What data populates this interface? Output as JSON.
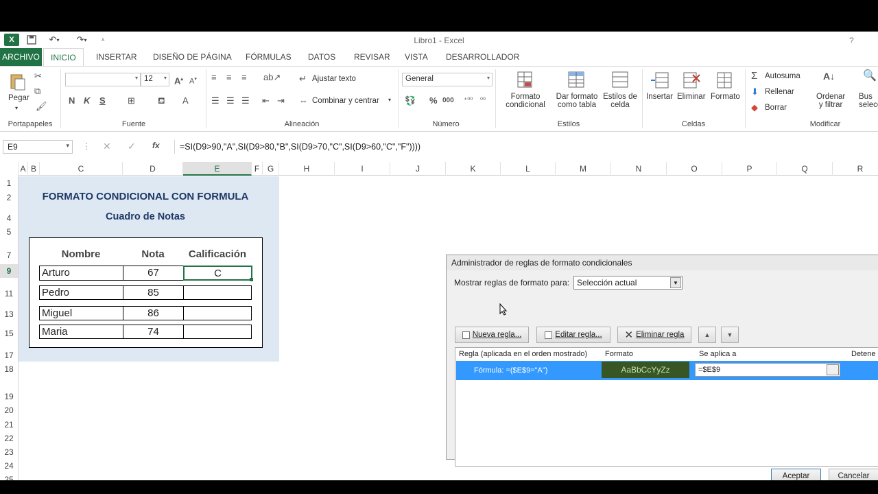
{
  "app": {
    "title": "Libro1 - Excel",
    "help": "?"
  },
  "tabs": [
    "ARCHIVO",
    "INICIO",
    "INSERTAR",
    "DISEÑO DE PÁGINA",
    "FÓRMULAS",
    "DATOS",
    "REVISAR",
    "VISTA",
    "DESARROLLADOR"
  ],
  "ribbon": {
    "portapapeles": {
      "pegar": "Pegar",
      "label": "Portapapeles"
    },
    "fuente": {
      "size": "12",
      "bold": "N",
      "italic": "K",
      "underline": "S",
      "label": "Fuente"
    },
    "alineacion": {
      "ajustar": "Ajustar texto",
      "combinar": "Combinar y centrar",
      "label": "Alineación"
    },
    "numero": {
      "format": "General",
      "label": "Número"
    },
    "estilos": {
      "formato_condicional": [
        "Formato",
        "condicional"
      ],
      "dar_formato": [
        "Dar formato",
        "como tabla"
      ],
      "estilos_celda": [
        "Estilos de",
        "celda"
      ],
      "label": "Estilos"
    },
    "celdas": {
      "insertar": "Insertar",
      "eliminar": "Eliminar",
      "formato": "Formato",
      "label": "Celdas"
    },
    "modificar": {
      "autosuma": "Autosuma",
      "rellenar": "Rellenar",
      "borrar": "Borrar",
      "ordenar": [
        "Ordenar",
        "y filtrar"
      ],
      "buscar": [
        "Bus",
        "selecc"
      ],
      "label": "Modificar"
    }
  },
  "formula_bar": {
    "name_box": "E9",
    "fx": "fx",
    "formula": "=SI(D9>90,\"A\",SI(D9>80,\"B\",SI(D9>70,\"C\",SI(D9>60,\"C\",\"F\"))))"
  },
  "columns": [
    "A",
    "B",
    "C",
    "D",
    "E",
    "F",
    "G",
    "H",
    "I",
    "J",
    "K",
    "L",
    "M",
    "N",
    "O",
    "P",
    "Q",
    "R"
  ],
  "rows": [
    "1",
    "2",
    "4",
    "5",
    "7",
    "9",
    "11",
    "13",
    "15",
    "17",
    "18",
    "19",
    "20",
    "21",
    "22",
    "23",
    "24",
    "25"
  ],
  "sheet": {
    "title": "FORMATO CONDICIONAL CON FORMULA",
    "subtitle": "Cuadro de Notas",
    "headers": [
      "Nombre",
      "Nota",
      "Calificación"
    ],
    "data": [
      [
        "Arturo",
        "67",
        "C"
      ],
      [
        "Pedro",
        "85",
        ""
      ],
      [
        "Miguel",
        "86",
        ""
      ],
      [
        "Maria",
        "74",
        ""
      ]
    ]
  },
  "dialog": {
    "title": "Administrador de reglas de formato condicionales",
    "show_label": "Mostrar reglas de formato para:",
    "show_value": "Selección actual",
    "new_rule": "Nueva regla...",
    "edit_rule": "Editar regla...",
    "delete_rule": "Eliminar regla",
    "col_rule": "Regla (aplicada en el orden mostrado)",
    "col_format": "Formato",
    "col_applies": "Se aplica a",
    "col_stop": "Detene",
    "rule_text": "Fórmula: =($E$9=\"A\")",
    "format_preview": "AaBbCcYyZz",
    "applies_value": "=$E$9",
    "accept": "Aceptar",
    "cancel": "Cancelar"
  },
  "colors": {
    "excel_green": "#217346",
    "selected_row": "#3399ff",
    "format_bg": "#375623",
    "block_bg": "#dde8f3"
  }
}
